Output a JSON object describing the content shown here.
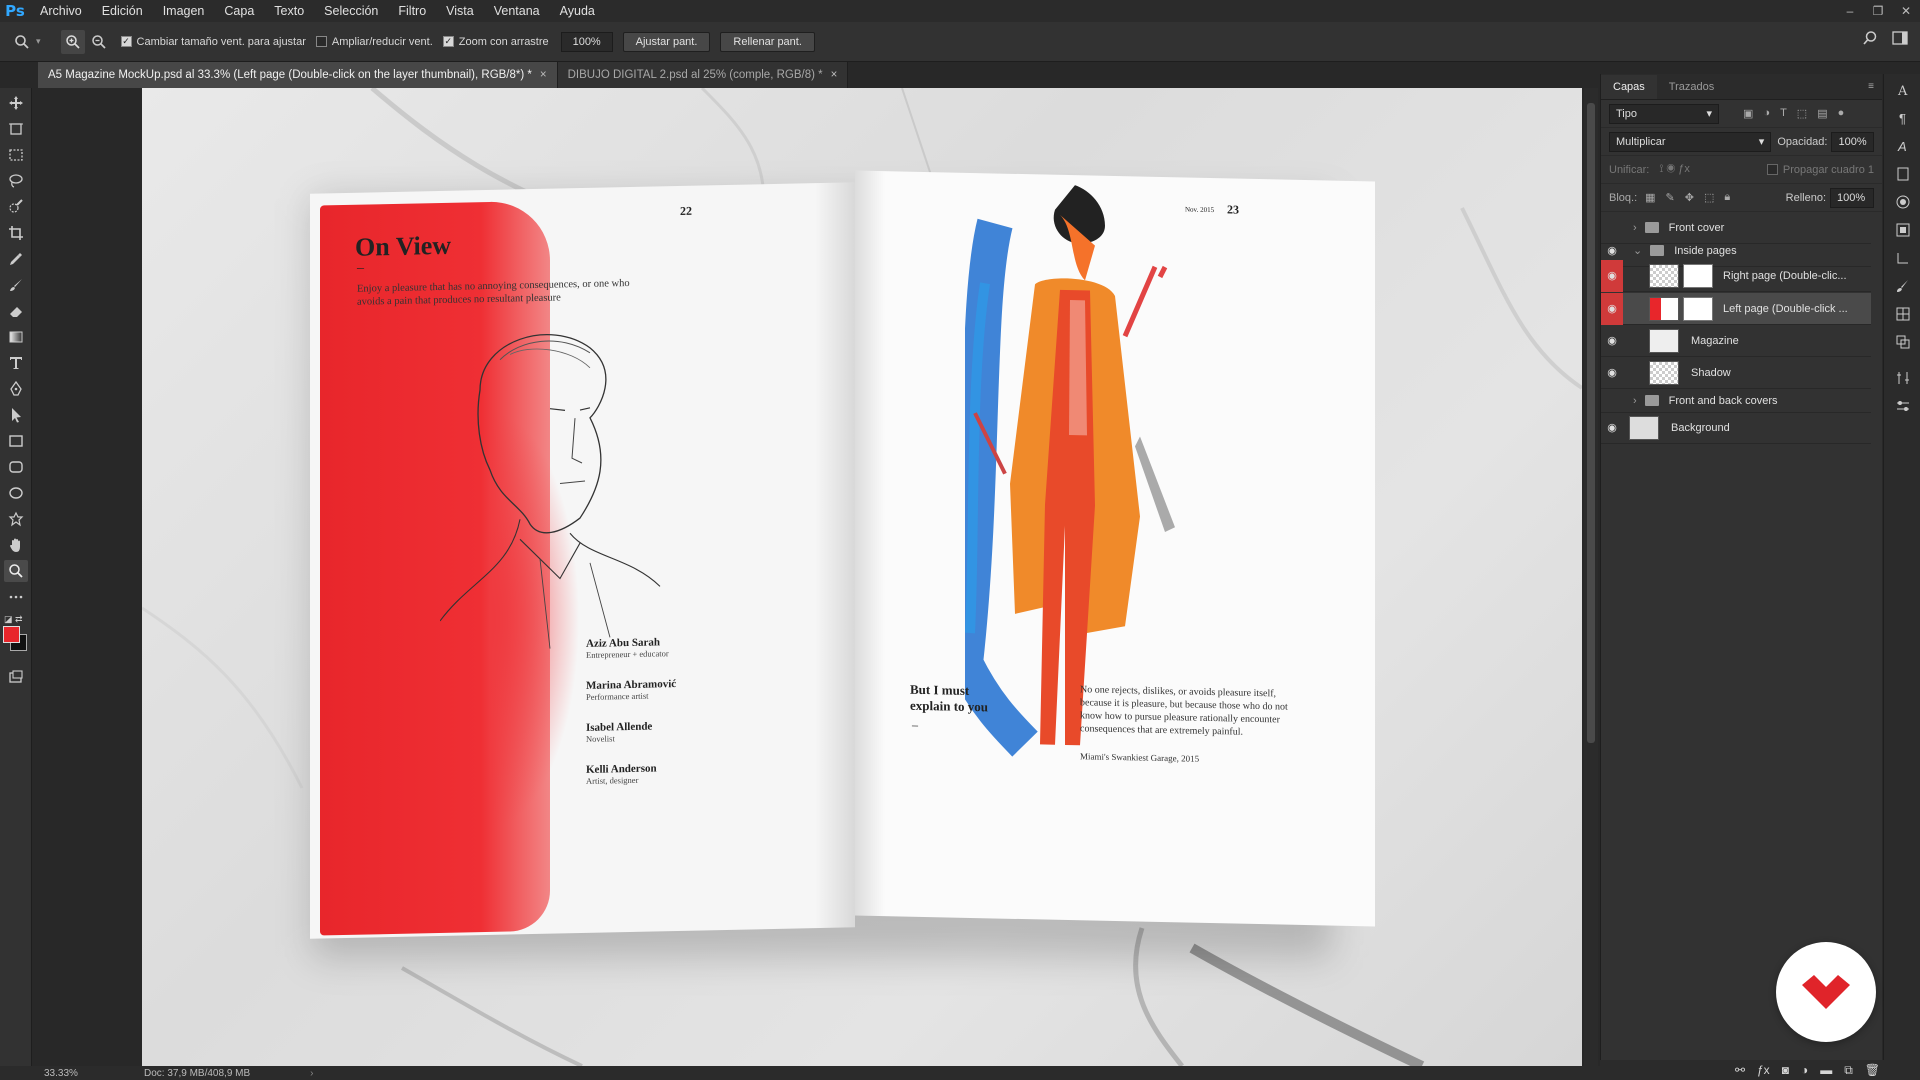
{
  "app": {
    "logo": "Ps"
  },
  "menu": [
    "Archivo",
    "Edición",
    "Imagen",
    "Capa",
    "Texto",
    "Selección",
    "Filtro",
    "Vista",
    "Ventana",
    "Ayuda"
  ],
  "options": {
    "resize_windows": "Cambiar tamaño vent. para ajustar",
    "zoom_all": "Ampliar/reducir vent.",
    "scrubby_zoom": "Zoom con arrastre",
    "zoom_value": "100%",
    "fit_screen": "Ajustar pant.",
    "fill_screen": "Rellenar pant."
  },
  "tabs": [
    {
      "label": "A5 Magazine MockUp.psd al 33.3% (Left page (Double-click on the layer thumbnail), RGB/8*) *",
      "close": "×"
    },
    {
      "label": "DIBUJO DIGITAL 2.psd al 25% (comple, RGB/8) *",
      "close": "×"
    }
  ],
  "status": {
    "zoom": "33.33%",
    "doc": "Doc: 37,9 MB/408,9 MB"
  },
  "layers_panel": {
    "tabs": [
      "Capas",
      "Trazados"
    ],
    "filter": "Tipo",
    "blend_mode": "Multiplicar",
    "opacity_label": "Opacidad:",
    "opacity_value": "100%",
    "unify_label": "Unificar:",
    "propagate": "Propagar cuadro 1",
    "lock_label": "Bloq.:",
    "fill_label": "Relleno:",
    "fill_value": "100%",
    "layers": [
      {
        "name": "Front cover"
      },
      {
        "name": "Inside pages"
      },
      {
        "name": "Right page (Double-clic..."
      },
      {
        "name": "Left page (Double-click ..."
      },
      {
        "name": "Magazine"
      },
      {
        "name": "Shadow"
      },
      {
        "name": "Front and back covers"
      },
      {
        "name": "Background"
      }
    ]
  },
  "magazine": {
    "left": {
      "page_num": "22",
      "title": "On View",
      "dash": "–",
      "intro": "Enjoy a pleasure that has no annoying consequences, or one who avoids a pain that produces no resultant pleasure",
      "credits": [
        {
          "name": "Aziz Abu Sarah",
          "role": "Entrepreneur + educator"
        },
        {
          "name": "Marina Abramović",
          "role": "Performance artist"
        },
        {
          "name": "Isabel Allende",
          "role": "Novelist"
        },
        {
          "name": "Kelli Anderson",
          "role": "Artist, designer"
        }
      ]
    },
    "right": {
      "date": "Nov. 2015",
      "page_num": "23",
      "heading_line1": "But I must",
      "heading_line2": "explain to you",
      "dash": "–",
      "body": "No one rejects, dislikes, or avoids pleasure itself, because it is pleasure, but because those who do not know how to pursue pleasure rationally encounter consequences that are extremely painful.",
      "caption": "Miami's Swankiest Garage, 2015"
    }
  },
  "colors": {
    "accent": "#31a8ff",
    "eye_active": "#d03a3a",
    "fg_color": "#e8262b",
    "brand_red": "#e0242a"
  }
}
